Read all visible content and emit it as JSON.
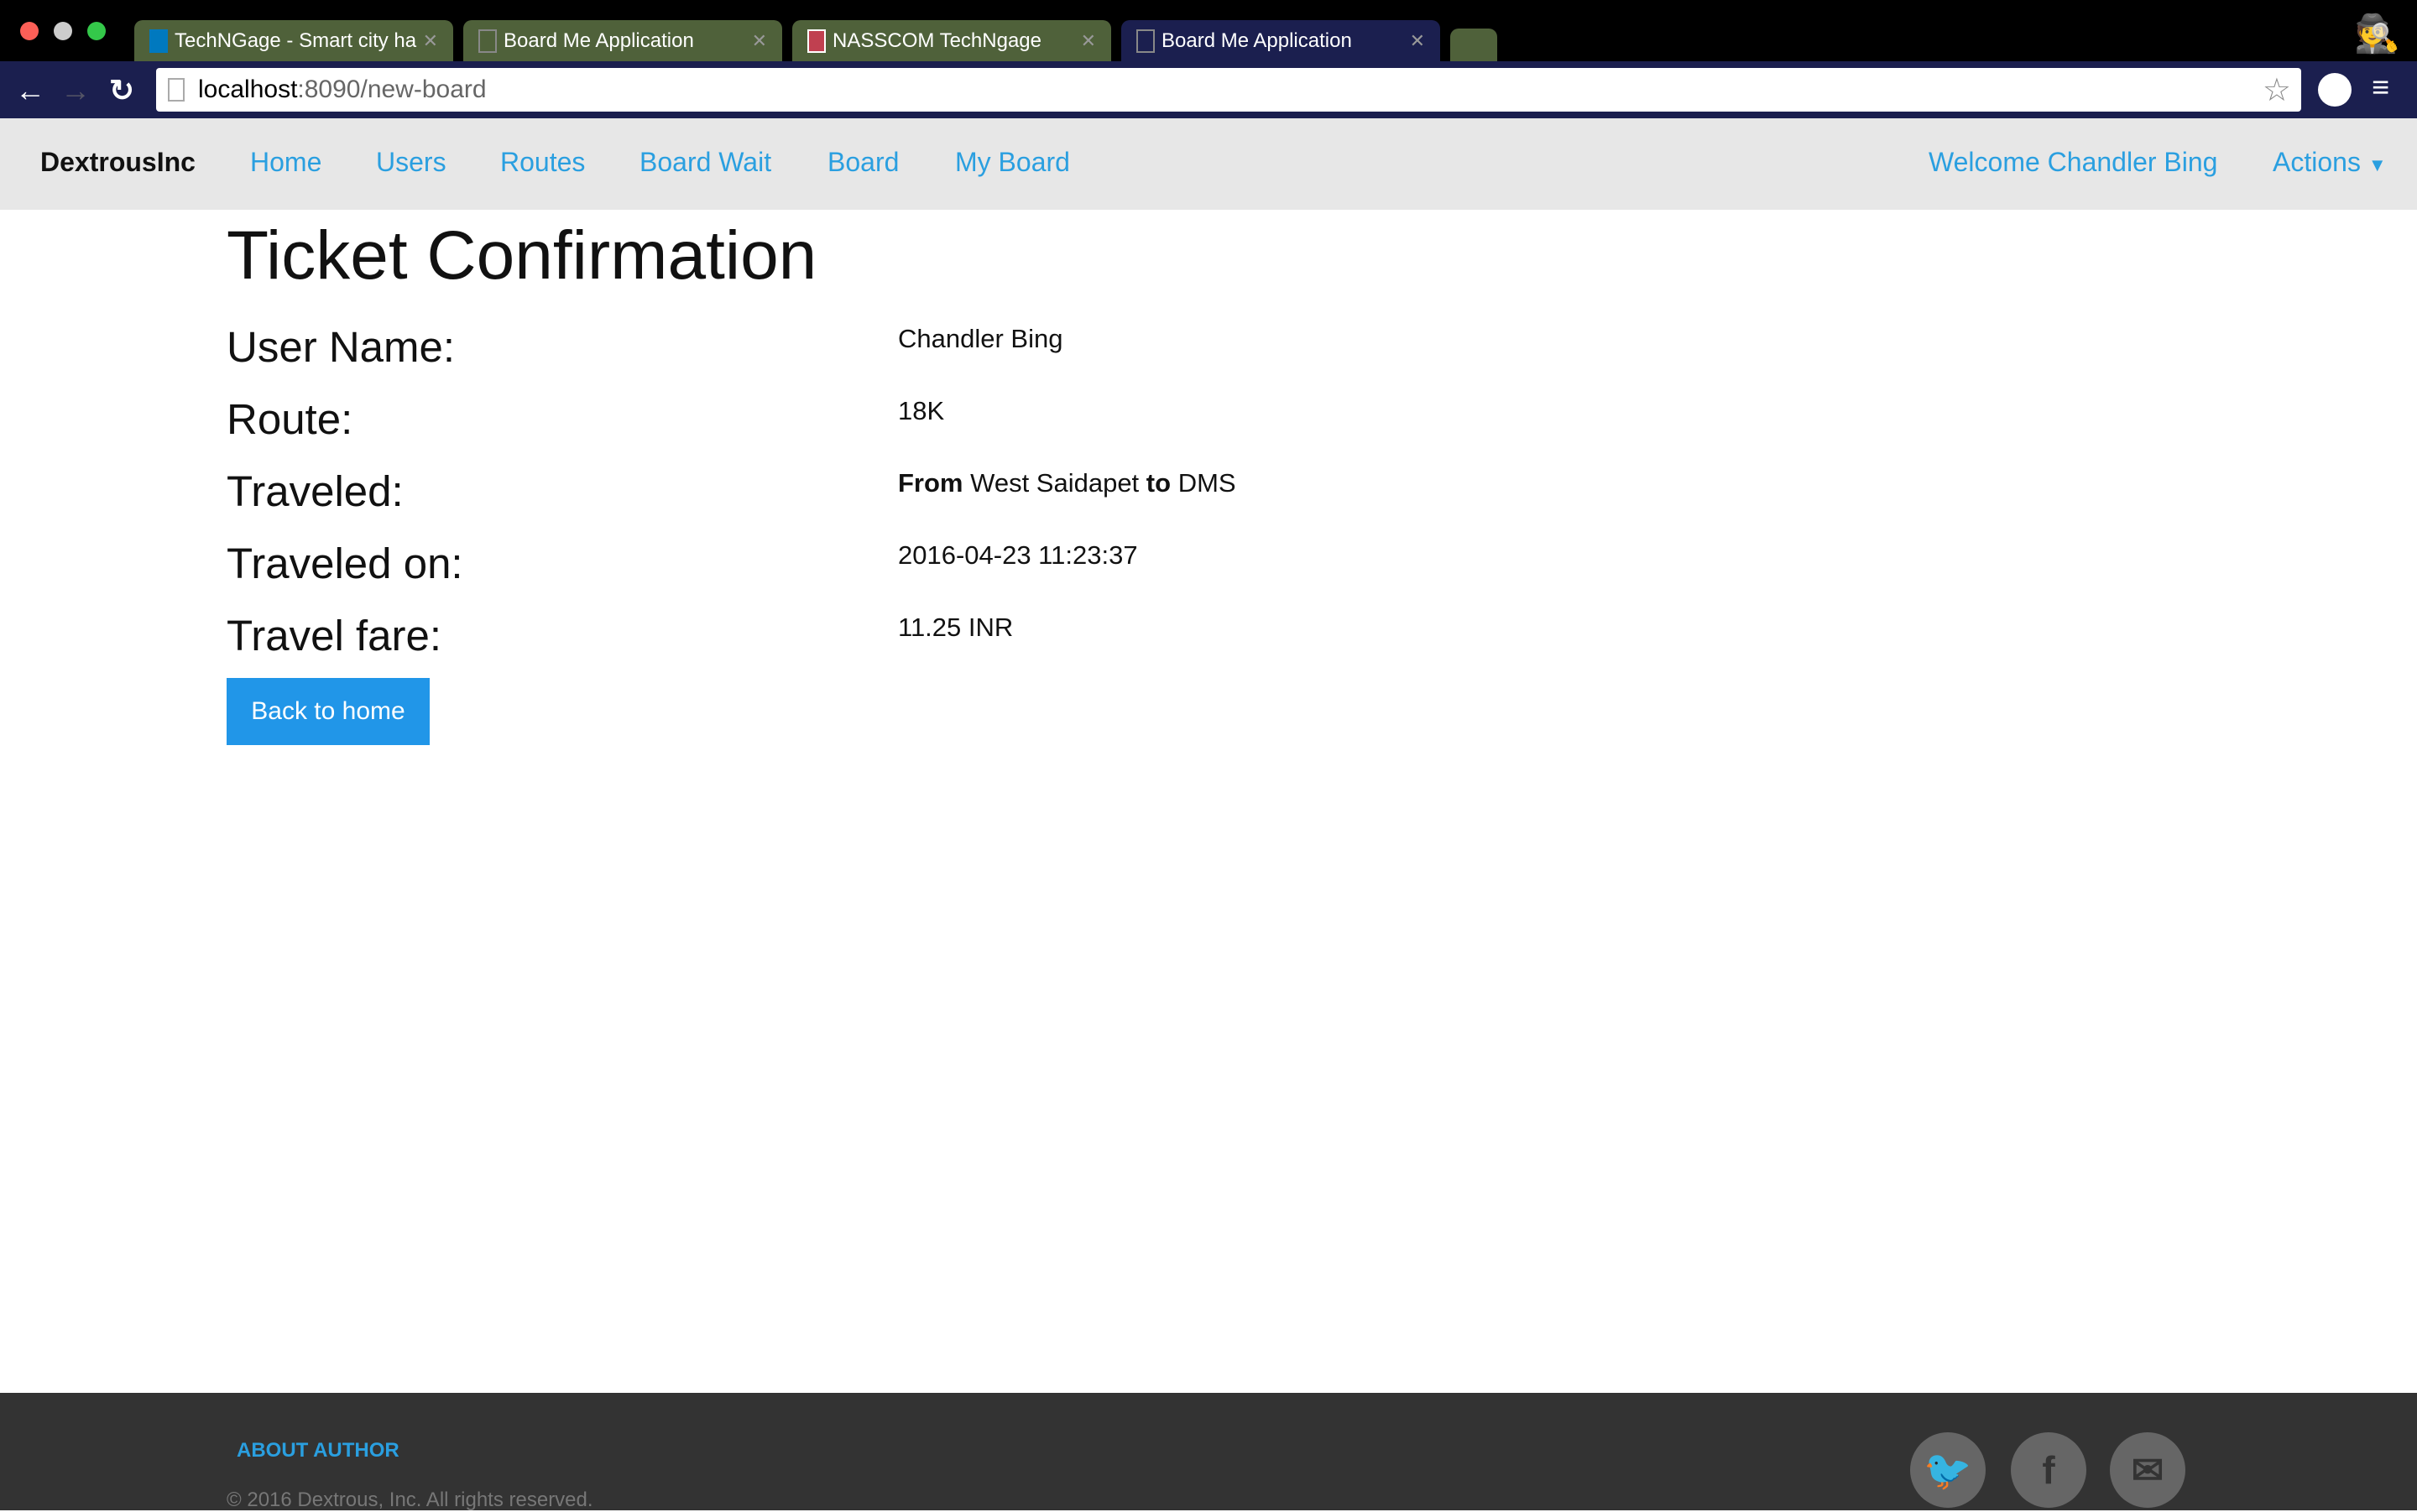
{
  "browser": {
    "tabs": [
      {
        "title": "TechNGage - Smart city ha"
      },
      {
        "title": "Board Me Application"
      },
      {
        "title": "NASSCOM TechNgage"
      },
      {
        "title": "Board Me Application",
        "active": true
      }
    ],
    "url_host": "localhost",
    "url_path": ":8090/new-board"
  },
  "navbar": {
    "brand": "DextrousInc",
    "links": [
      "Home",
      "Users",
      "Routes",
      "Board Wait",
      "Board",
      "My Board"
    ],
    "welcome": "Welcome Chandler Bing",
    "actions": "Actions"
  },
  "page": {
    "title": "Ticket Confirmation",
    "fields": [
      {
        "label": "User Name:",
        "value": "Chandler Bing"
      },
      {
        "label": "Route:",
        "value": "18K"
      },
      {
        "label": "Traveled:",
        "from_label": "From",
        "from": "West Saidapet",
        "to_label": "to",
        "to": "DMS"
      },
      {
        "label": "Traveled on:",
        "value": "2016-04-23 11:23:37"
      },
      {
        "label": "Travel fare:",
        "value": "11.25 INR"
      }
    ],
    "back_button": "Back to home"
  },
  "footer": {
    "about": "ABOUT AUTHOR",
    "copyright": "© 2016 Dextrous, Inc. All rights reserved.",
    "social": [
      "twitter-icon",
      "facebook-icon",
      "email-icon"
    ]
  },
  "colors": {
    "accent": "#2196e8",
    "link": "#2a9fe0",
    "footer": "#333333",
    "navbar": "#e7e7e7"
  }
}
